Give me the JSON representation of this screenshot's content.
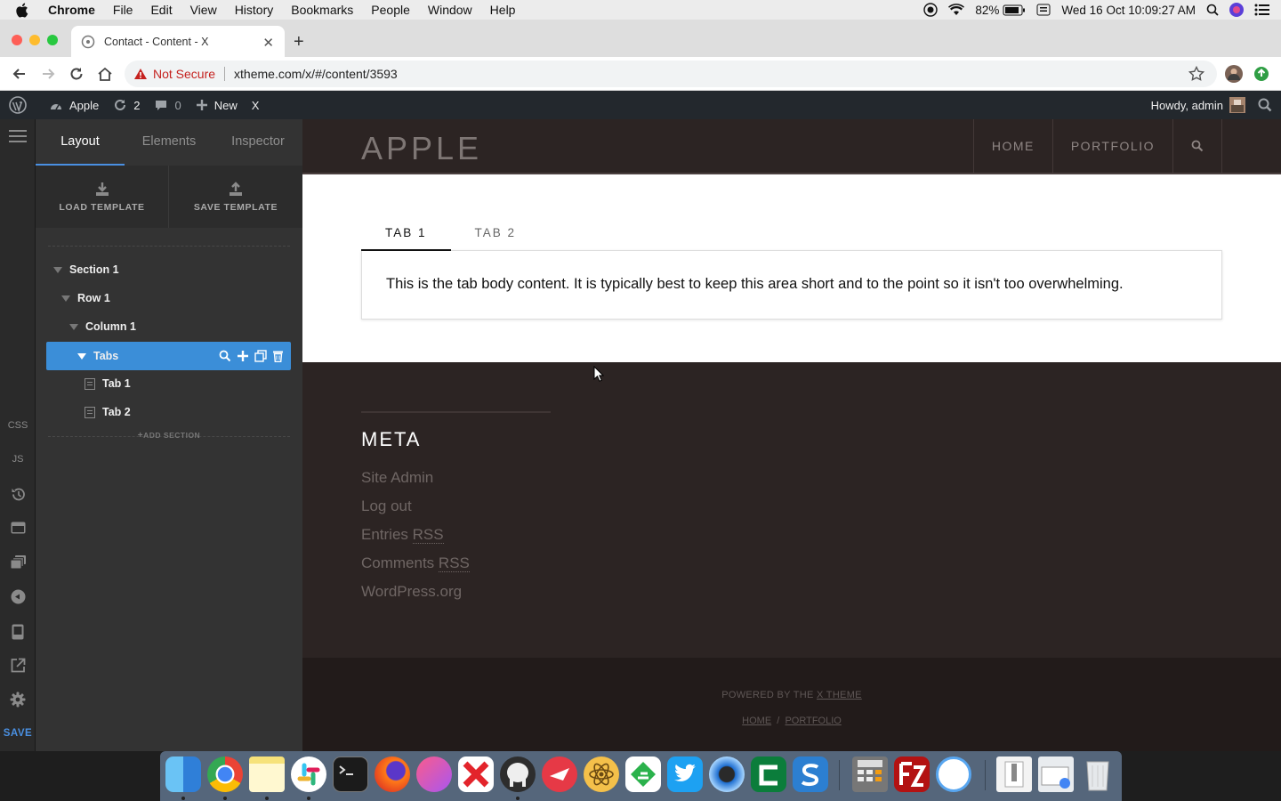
{
  "menubar": {
    "app": "Chrome",
    "items": [
      "File",
      "Edit",
      "View",
      "History",
      "Bookmarks",
      "People",
      "Window",
      "Help"
    ],
    "battery": "82%",
    "datetime": "Wed 16 Oct  10:09:27 AM"
  },
  "browser": {
    "tab_title": "Contact - Content - X",
    "security_label": "Not Secure",
    "url": "xtheme.com/x/#/content/3593"
  },
  "wpbar": {
    "site_name": "Apple",
    "updates_count": "2",
    "comments_count": "0",
    "new_label": "New",
    "x_label": "X",
    "howdy": "Howdy, admin"
  },
  "rail": {
    "css_label": "CSS",
    "js_label": "JS",
    "save_label": "SAVE"
  },
  "panel": {
    "tabs": [
      "Layout",
      "Elements",
      "Inspector"
    ],
    "load_template": "LOAD TEMPLATE",
    "save_template": "SAVE TEMPLATE",
    "tree": {
      "section": "Section 1",
      "row": "Row 1",
      "column": "Column 1",
      "tabs": "Tabs",
      "tab1": "Tab 1",
      "tab2": "Tab 2"
    },
    "add_section": "ADD SECTION"
  },
  "site": {
    "logo": "APPLE",
    "nav": [
      "HOME",
      "PORTFOLIO"
    ],
    "tabs": [
      "TAB 1",
      "TAB 2"
    ],
    "tab_body": "This is the tab body content. It is typically best to keep this area short and to the point so it isn't too overwhelming.",
    "widget_title": "META",
    "meta_links": [
      "Site Admin",
      "Log out"
    ],
    "entries_prefix": "Entries",
    "comments_prefix": "Comments",
    "rss": "RSS",
    "wordpress_link": "WordPress.org",
    "powered_prefix": "POWERED BY THE",
    "powered_link": "X THEME",
    "footer_nav": [
      "HOME",
      "PORTFOLIO"
    ],
    "footer_sep": "/"
  }
}
